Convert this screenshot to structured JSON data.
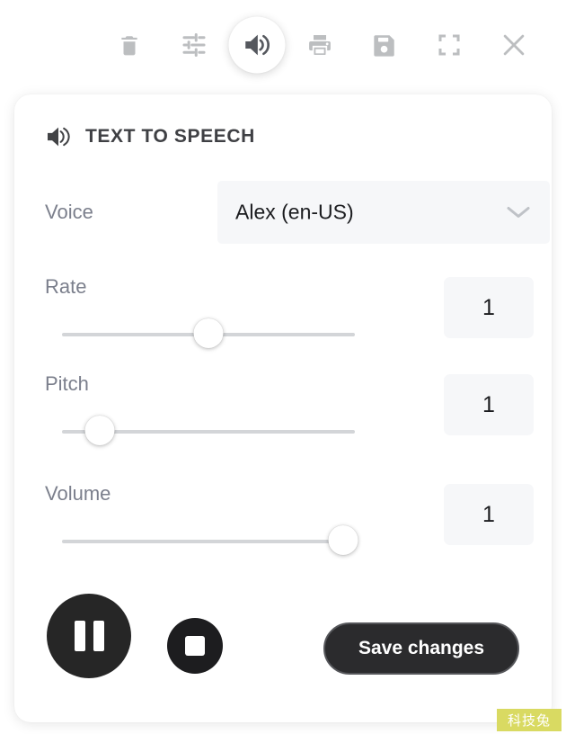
{
  "toolbar": {
    "buttons": [
      {
        "name": "delete",
        "icon": "trash-icon",
        "label": "Delete",
        "active": false
      },
      {
        "name": "settings",
        "icon": "tune-sliders-icon",
        "label": "Settings",
        "active": false
      },
      {
        "name": "text-to-speech",
        "icon": "speaker-volume-icon",
        "label": "Text to speech",
        "active": true
      },
      {
        "name": "print",
        "icon": "printer-icon",
        "label": "Print",
        "active": false
      },
      {
        "name": "save",
        "icon": "floppy-disk-icon",
        "label": "Save",
        "active": false
      },
      {
        "name": "fullscreen",
        "icon": "fullscreen-icon",
        "label": "Fullscreen",
        "active": false
      },
      {
        "name": "close",
        "icon": "close-x-icon",
        "label": "Close",
        "active": false
      }
    ]
  },
  "panel": {
    "icon": "speaker-volume-icon",
    "title": "TEXT TO SPEECH",
    "voice": {
      "label": "Voice",
      "selected": "Alex (en-US)",
      "chevron": "chevron-down-icon"
    },
    "sliders": [
      {
        "label": "Rate",
        "value": "1",
        "percent": 50
      },
      {
        "label": "Pitch",
        "value": "1",
        "percent": 13
      },
      {
        "label": "Volume",
        "value": "1",
        "percent": 96
      }
    ],
    "actions": {
      "pause_label": "Pause",
      "pause_icon": "pause-icon",
      "stop_label": "Stop",
      "stop_icon": "stop-icon",
      "save_label": "Save changes"
    }
  },
  "watermark": {
    "text": "科技兔",
    "background": "#d9da62"
  },
  "colors": {
    "card_background": "#ffffff",
    "page_background": "#ffffff",
    "field_background": "#f6f7f9",
    "label_text": "#7b7f8c",
    "value_text": "#1b1c1f",
    "title_text": "#3f4044",
    "toolbar_icon": "#bcbec0",
    "toolbar_icon_active": "#55585e",
    "track": "#d3d5d8",
    "dark_button": "#262626",
    "save_button": "#2b2b2d"
  }
}
